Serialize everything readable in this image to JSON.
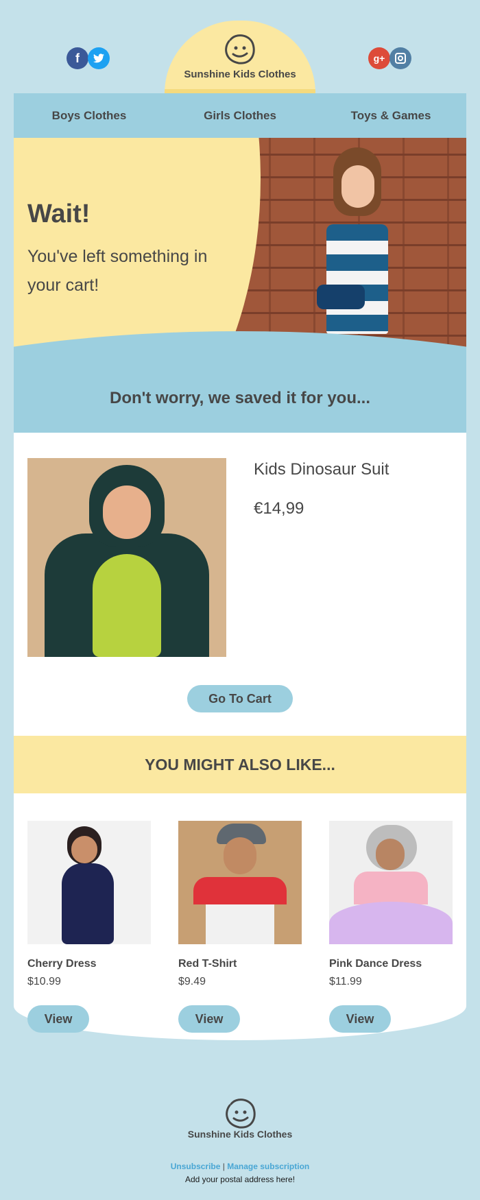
{
  "brand": {
    "name": "Sunshine Kids Clothes",
    "accent": "#9ccfdf",
    "yellow": "#fbe8a1"
  },
  "social": {
    "left": [
      "facebook-icon",
      "twitter-icon"
    ],
    "right": [
      "google-plus-icon",
      "instagram-icon"
    ],
    "fb": "f",
    "gp": "g+"
  },
  "nav": {
    "items": [
      "Boys Clothes",
      "Girls Clothes",
      "Toys & Games"
    ]
  },
  "hero": {
    "title": "Wait!",
    "subtitle": "You've left something in your cart!",
    "saved": "Don't worry, we saved it for you..."
  },
  "product": {
    "name": "Kids Dinosaur Suit",
    "price": "€14,99",
    "cta": "Go To Cart"
  },
  "also": {
    "title": "YOU MIGHT ALSO LIKE..."
  },
  "recs": [
    {
      "name": "Cherry Dress",
      "price": "$10.99",
      "cta": "View"
    },
    {
      "name": "Red T-Shirt",
      "price": "$9.49",
      "cta": "View"
    },
    {
      "name": "Pink Dance Dress",
      "price": "$11.99",
      "cta": "View"
    }
  ],
  "footer": {
    "brand": "Sunshine Kids Clothes",
    "unsubscribe": "Unsubscribe",
    "separator": "|",
    "manage": "Manage subscription",
    "address": "Add your postal address here!"
  }
}
